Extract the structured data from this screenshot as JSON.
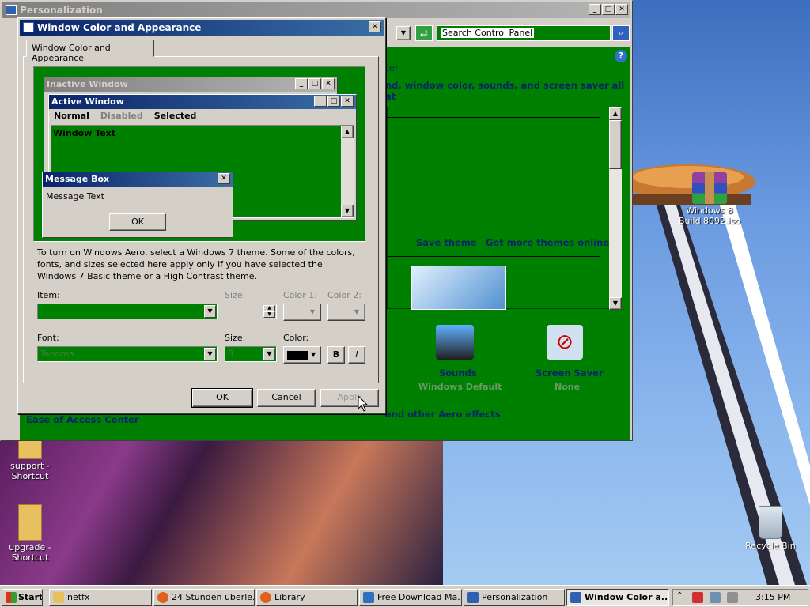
{
  "personalization": {
    "title": "Personalization",
    "search_placeholder": "Search Control Panel",
    "heading_fragment": "ter",
    "desc_fragment": "nd, window color, sounds, and screen saver all at",
    "save_theme": "Save theme",
    "get_more_themes": "Get more themes online",
    "sounds_label": "Sounds",
    "sounds_value": "Windows Default",
    "screensaver_label": "Screen Saver",
    "screensaver_value": "None",
    "ease_of_access": "Ease of Access Center",
    "aero_fragment": "and other Aero effects"
  },
  "dialog": {
    "title": "Window Color and Appearance",
    "tab": "Window Color and Appearance",
    "preview": {
      "inactive_title": "Inactive Window",
      "active_title": "Active Window",
      "menu_normal": "Normal",
      "menu_disabled": "Disabled",
      "menu_selected": "Selected",
      "window_text": "Window Text",
      "msgbox_title": "Message Box",
      "msgbox_text": "Message Text",
      "msgbox_ok": "OK"
    },
    "info": "To turn on Windows Aero, select a Windows 7 theme.  Some of the colors, fonts, and sizes selected here apply only if you have selected the Windows 7 Basic theme or a High Contrast theme.",
    "item_label": "Item:",
    "size_label": "Size:",
    "color1_label": "Color 1:",
    "color2_label": "Color 2:",
    "font_label": "Font:",
    "font_value": "Tahoma",
    "font_size_label": "Size:",
    "font_size_value": "8",
    "font_color_label": "Color:",
    "bold": "B",
    "italic": "I",
    "ok": "OK",
    "cancel": "Cancel",
    "apply": "Apply"
  },
  "desktop": {
    "icon_iso": "Windows 8 Build 8092.iso",
    "icon_support": "support - Shortcut",
    "icon_upgrade": "upgrade - Shortcut",
    "icon_recycle": "Recycle Bin"
  },
  "taskbar": {
    "start": "Start",
    "tasks": [
      "netfx",
      "24 Stunden überle...",
      "Library",
      "Free Download Ma...",
      "Personalization",
      "Window Color a..."
    ],
    "clock": "3:15 PM"
  },
  "colors": {
    "accent_green": "#008000",
    "title_blue": "#0a246a",
    "face": "#d4d0c8"
  }
}
